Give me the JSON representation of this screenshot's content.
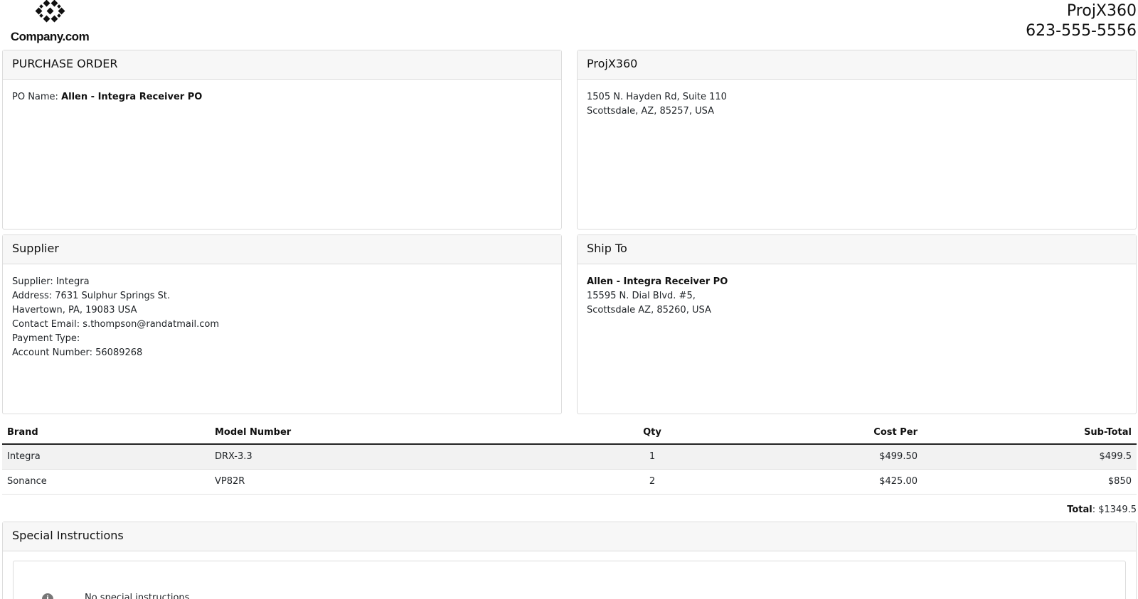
{
  "header": {
    "logo_text": "Company.com",
    "company_name": "ProjX360",
    "company_phone": "623-555-5556"
  },
  "purchase_order": {
    "title": "PURCHASE ORDER",
    "po_name_label": "PO Name: ",
    "po_name_value": "Allen - Integra Receiver PO"
  },
  "company_card": {
    "title": "ProjX360",
    "address_line1": "1505 N. Hayden Rd, Suite 110",
    "address_line2": "Scottsdale, AZ, 85257, USA"
  },
  "supplier": {
    "title": "Supplier",
    "lines": [
      "Supplier: Integra",
      "Address: 7631 Sulphur Springs St.",
      "Havertown, PA, 19083 USA",
      "Contact Email: s.thompson@randatmail.com",
      "Payment Type:",
      "Account Number: 56089268"
    ]
  },
  "ship_to": {
    "title": "Ship To",
    "name": "Allen - Integra Receiver PO",
    "address_line1": "15595 N. Dial Blvd. #5,",
    "address_line2": "Scottsdale AZ, 85260, USA"
  },
  "items": {
    "columns": [
      "Brand",
      "Model Number",
      "Qty",
      "Cost Per",
      "Sub-Total"
    ],
    "rows": [
      {
        "brand": "Integra",
        "model": "DRX-3.3",
        "qty": "1",
        "cost": "$499.50",
        "subtotal": "$499.5"
      },
      {
        "brand": "Sonance",
        "model": "VP82R",
        "qty": "2",
        "cost": "$425.00",
        "subtotal": "$850"
      }
    ]
  },
  "totals": {
    "label": "Total",
    "value": ": $1349.5"
  },
  "special_instructions": {
    "title": "Special Instructions",
    "info_icon": "i",
    "text": "No special instructions."
  }
}
